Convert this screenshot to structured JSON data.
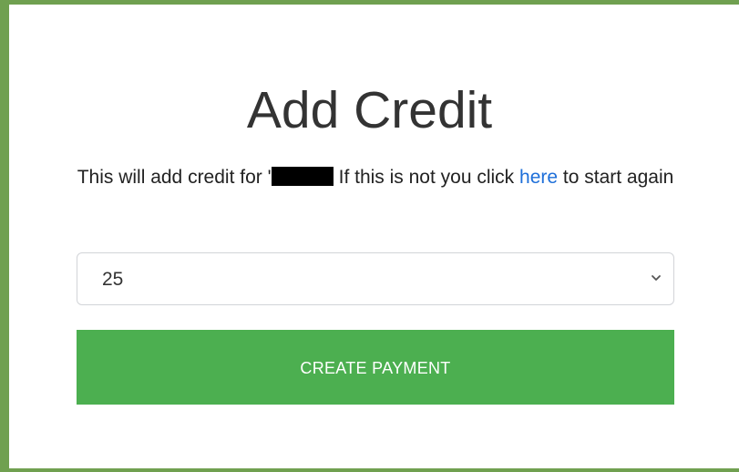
{
  "page": {
    "title": "Add Credit"
  },
  "description": {
    "prefix": "This will add credit for '",
    "middle": "If this is not you click ",
    "link": "here",
    "suffix": " to start again"
  },
  "amount_select": {
    "selected_value": "25"
  },
  "actions": {
    "create_payment_label": "CREATE PAYMENT"
  },
  "colors": {
    "frame_border": "#70a050",
    "button_bg": "#4caf50",
    "link": "#1e6fd9"
  },
  "icons": {
    "select_arrow": "chevron-down-icon"
  }
}
